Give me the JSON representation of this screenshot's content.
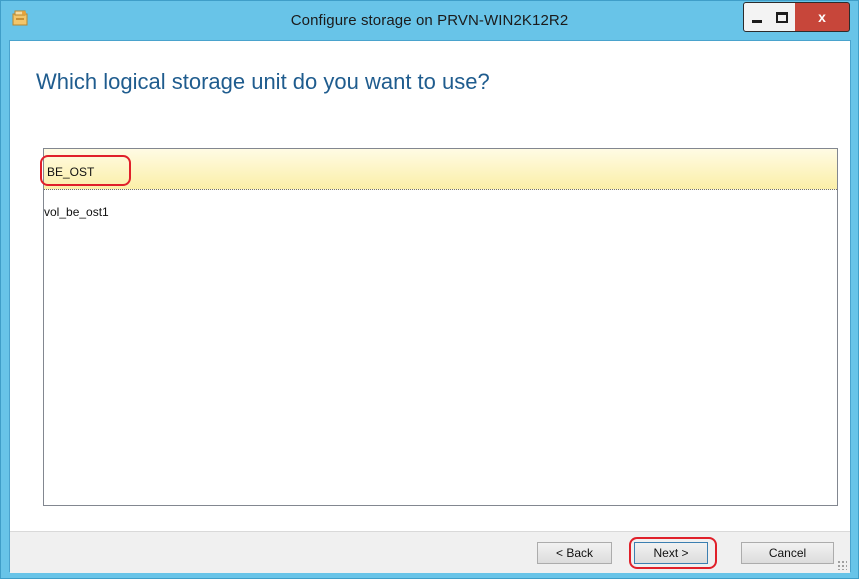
{
  "window": {
    "title": "Configure storage on PRVN-WIN2K12R2",
    "icon": "wizard-app-icon",
    "controls": {
      "minimize_icon": "minimize-icon",
      "maximize_icon": "maximize-icon",
      "close_label": "x"
    }
  },
  "main": {
    "heading": "Which logical storage unit do you want to use?",
    "list": {
      "group_header": "BE_OST",
      "items": [
        "vol_be_ost1"
      ]
    }
  },
  "footer": {
    "back_label": "< Back",
    "next_label": "Next >",
    "cancel_label": "Cancel"
  },
  "colors": {
    "titlebar": "#68c4e8",
    "heading": "#1f5c8e",
    "annotation": "#e0202a",
    "close_button": "#c7463a"
  }
}
